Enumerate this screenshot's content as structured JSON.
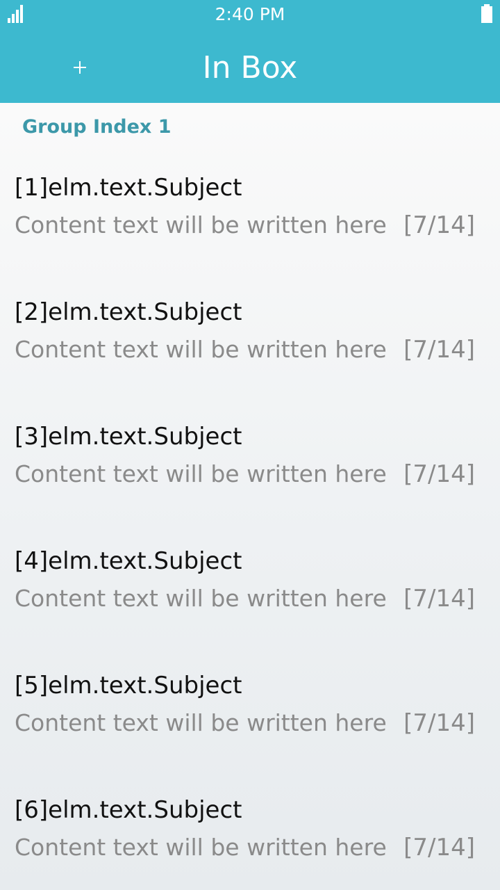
{
  "status_bar": {
    "time": "2:40 PM",
    "signal_icon": "signal-icon",
    "battery_icon": "battery-icon"
  },
  "header": {
    "title": "In Box",
    "add_label": "+",
    "background_color": "#3db9cf"
  },
  "list": {
    "group_title": "Group Index 1",
    "items": [
      {
        "subject": "[1]elm.text.Subject",
        "content": "Content text will be written here",
        "counter": "[7/14]"
      },
      {
        "subject": "[2]elm.text.Subject",
        "content": "Content text will be written here",
        "counter": "[7/14]"
      },
      {
        "subject": "[3]elm.text.Subject",
        "content": "Content text will be written here",
        "counter": "[7/14]"
      },
      {
        "subject": "[4]elm.text.Subject",
        "content": "Content text will be written here",
        "counter": "[7/14]"
      },
      {
        "subject": "[5]elm.text.Subject",
        "content": "Content text will be written here",
        "counter": "[7/14]"
      },
      {
        "subject": "[6]elm.text.Subject",
        "content": "Content text will be written here",
        "counter": "[7/14]"
      }
    ]
  }
}
